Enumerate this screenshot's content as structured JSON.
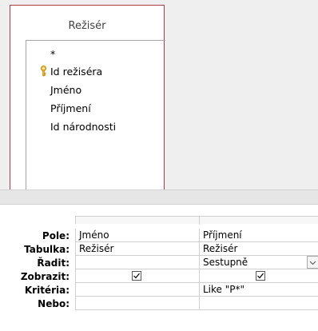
{
  "table": {
    "title": "Režisér",
    "fields": [
      {
        "label": "*",
        "primary_key": false
      },
      {
        "label": "Id režiséra",
        "primary_key": true
      },
      {
        "label": "Jméno",
        "primary_key": false
      },
      {
        "label": "Příjmení",
        "primary_key": false
      },
      {
        "label": "Id národnosti",
        "primary_key": false
      }
    ],
    "border_color": "#b23a48",
    "key_icon": "key-icon"
  },
  "grid": {
    "row_labels": {
      "pole": "Pole:",
      "tabulka": "Tabulka:",
      "radit": "Řadit:",
      "zobrazit": "Zobrazit:",
      "kriteria": "Kritéria:",
      "nebo": "Nebo:"
    },
    "columns": [
      {
        "pole": "Jméno",
        "tabulka": "Režisér",
        "radit": "",
        "zobrazit": true,
        "kriteria": "",
        "nebo": ""
      },
      {
        "pole": "Příjmení",
        "tabulka": "Režisér",
        "radit": "Sestupně",
        "zobrazit": true,
        "kriteria": "Like \"P*\"",
        "nebo": ""
      }
    ]
  }
}
